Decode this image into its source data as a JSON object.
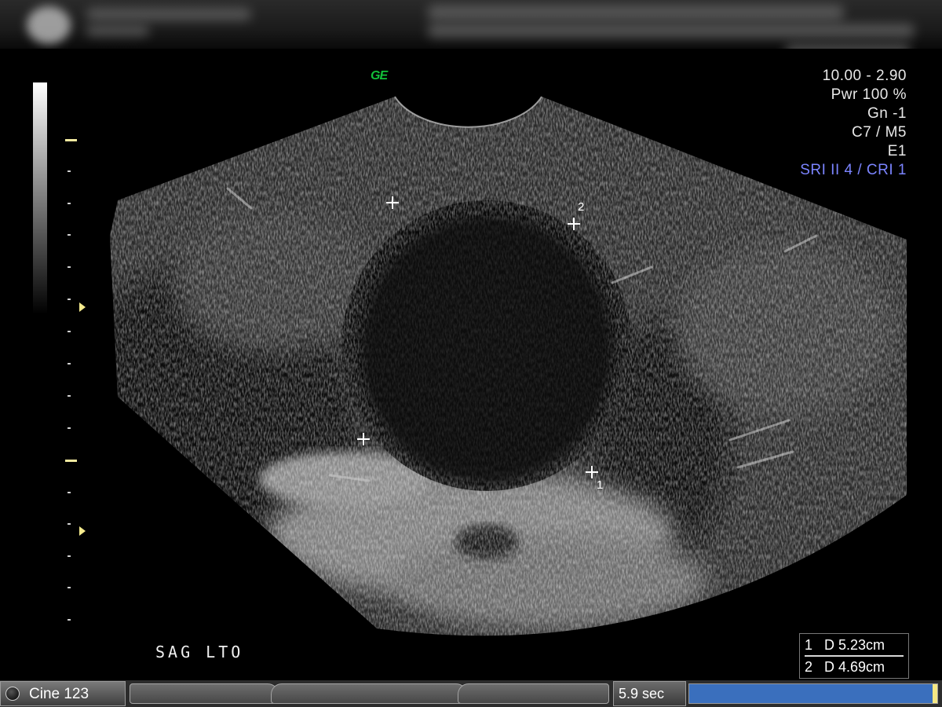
{
  "header": {
    "text_blurred": true
  },
  "probe_mark": "GE",
  "parameters": [
    "10.00 - 2.90",
    "Pwr 100 %",
    "Gn  -1",
    "C7 / M5",
    "E1"
  ],
  "parameters_accent": "SRI II 4 / CRI 1",
  "calipers": {
    "label_1": "1",
    "label_2": "2"
  },
  "plane_label": "SAG LTO",
  "measurements": {
    "row1": "1   D 5.23cm",
    "row2": "2   D 4.69cm"
  },
  "status": {
    "cine_label": "Cine 123",
    "time_label": "5.9 sec",
    "cine_progress_fraction": 0.985
  },
  "colors": {
    "probe_mark": "#12c13a",
    "accent_text": "#7b84ff",
    "ruler_major": "#f2e9a0",
    "progress_fill": "#3a6fbd"
  }
}
